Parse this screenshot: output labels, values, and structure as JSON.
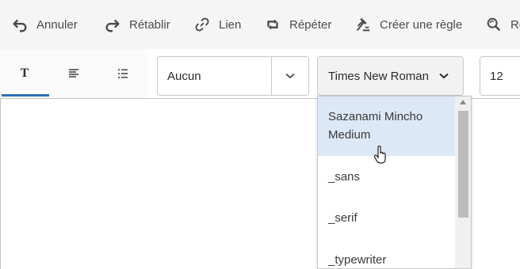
{
  "toolbar": {
    "undo_label": "Annuler",
    "redo_label": "Rétablir",
    "link_label": "Lien",
    "repeat_label": "Répéter",
    "rule_label": "Créer une règle",
    "find_label": "Re"
  },
  "tabs": [
    {
      "id": "character",
      "label": "T",
      "active": true
    },
    {
      "id": "paragraph",
      "icon": "align-icon"
    },
    {
      "id": "list",
      "icon": "list-icon"
    }
  ],
  "style_select": {
    "value": "Aucun"
  },
  "font_select": {
    "value": "Times New Roman"
  },
  "size_select": {
    "value": "12"
  },
  "font_options": [
    {
      "label": "Sazanami Mincho Medium",
      "highlighted": true
    },
    {
      "label": "_sans"
    },
    {
      "label": "_serif"
    },
    {
      "label": "_typewriter"
    }
  ],
  "colors": {
    "toolbar_bg": "#f5f5f5",
    "highlight": "#dde8f6",
    "active_tab": "#2f6fb8"
  }
}
